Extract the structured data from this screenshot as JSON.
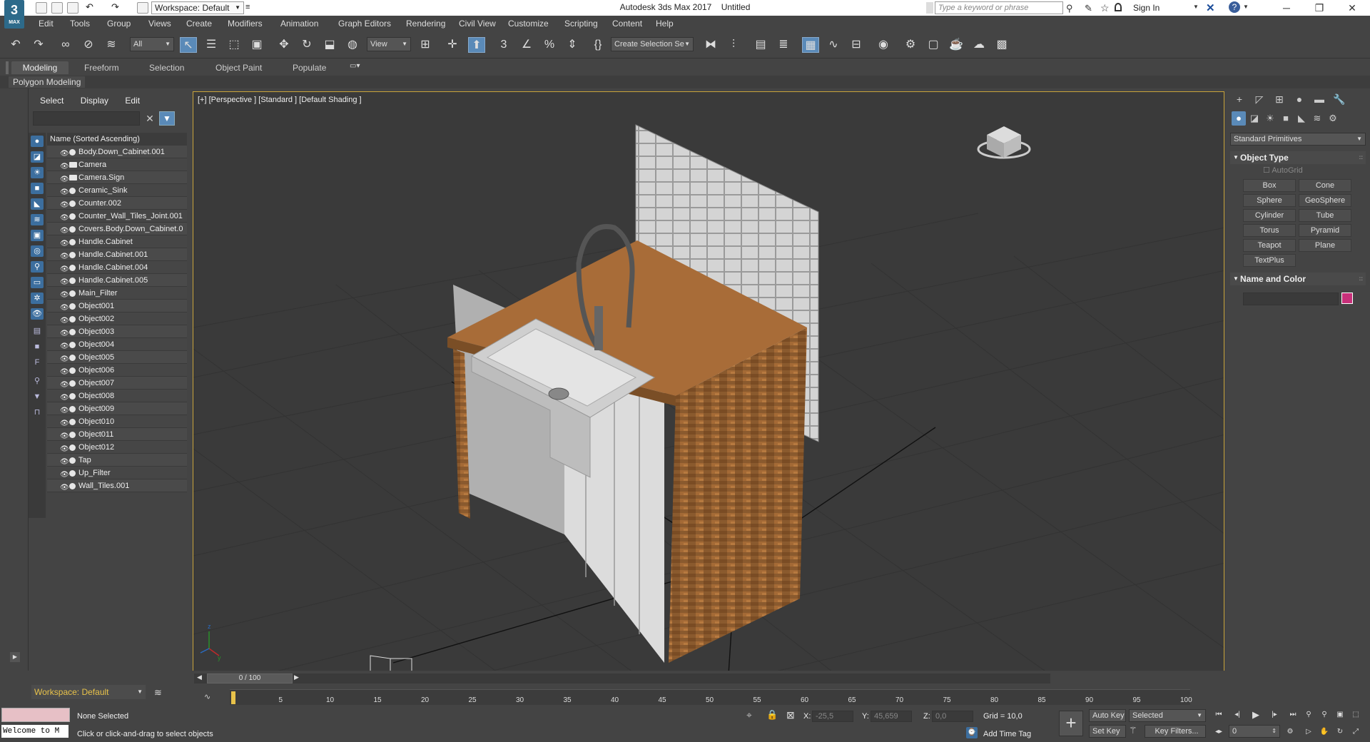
{
  "titlebar": {
    "logo": "3",
    "logo_sub": "MAX",
    "workspace": "Workspace: Default",
    "app_title": "Autodesk 3ds Max 2017",
    "doc_title": "Untitled",
    "search_placeholder": "Type a keyword or phrase",
    "sign_in": "Sign In"
  },
  "menu": [
    "Edit",
    "Tools",
    "Group",
    "Views",
    "Create",
    "Modifiers",
    "Animation",
    "Graph Editors",
    "Rendering",
    "Civil View",
    "Customize",
    "Scripting",
    "Content",
    "Help"
  ],
  "toolbar": {
    "filter_all": "All",
    "view_dd": "View",
    "selection_set": "Create Selection Se"
  },
  "ribbon": {
    "tabs": [
      "Modeling",
      "Freeform",
      "Selection",
      "Object Paint",
      "Populate"
    ],
    "sub": "Polygon Modeling"
  },
  "explorer": {
    "tabs": [
      "Select",
      "Display",
      "Edit"
    ],
    "header": "Name (Sorted Ascending)",
    "items": [
      {
        "name": "Body.Down_Cabinet.001",
        "type": "geom"
      },
      {
        "name": "Camera",
        "type": "cam"
      },
      {
        "name": "Camera.Sign",
        "type": "cam"
      },
      {
        "name": "Ceramic_Sink",
        "type": "geom"
      },
      {
        "name": "Counter.002",
        "type": "geom"
      },
      {
        "name": "Counter_Wall_Tiles_Joint.001",
        "type": "geom"
      },
      {
        "name": "Covers.Body.Down_Cabinet.0",
        "type": "geom"
      },
      {
        "name": "Handle.Cabinet",
        "type": "geom"
      },
      {
        "name": "Handle.Cabinet.001",
        "type": "geom"
      },
      {
        "name": "Handle.Cabinet.004",
        "type": "geom"
      },
      {
        "name": "Handle.Cabinet.005",
        "type": "geom"
      },
      {
        "name": "Main_Filter",
        "type": "geom"
      },
      {
        "name": "Object001",
        "type": "geom"
      },
      {
        "name": "Object002",
        "type": "geom"
      },
      {
        "name": "Object003",
        "type": "geom"
      },
      {
        "name": "Object004",
        "type": "geom"
      },
      {
        "name": "Object005",
        "type": "geom"
      },
      {
        "name": "Object006",
        "type": "geom"
      },
      {
        "name": "Object007",
        "type": "geom"
      },
      {
        "name": "Object008",
        "type": "geom"
      },
      {
        "name": "Object009",
        "type": "geom"
      },
      {
        "name": "Object010",
        "type": "geom"
      },
      {
        "name": "Object011",
        "type": "geom"
      },
      {
        "name": "Object012",
        "type": "geom"
      },
      {
        "name": "Tap",
        "type": "geom"
      },
      {
        "name": "Up_Filter",
        "type": "geom"
      },
      {
        "name": "Wall_Tiles.001",
        "type": "geom"
      }
    ]
  },
  "viewport": {
    "label": "[+] [Perspective ] [Standard ] [Default Shading ]"
  },
  "command_panel": {
    "category": "Standard Primitives",
    "object_type_title": "Object Type",
    "autogrid": "AutoGrid",
    "buttons": [
      "Box",
      "Cone",
      "Sphere",
      "GeoSphere",
      "Cylinder",
      "Tube",
      "Torus",
      "Pyramid",
      "Teapot",
      "Plane",
      "TextPlus"
    ],
    "name_color_title": "Name and Color",
    "swatch_color": "#c8307a"
  },
  "bottom": {
    "workspace": "Workspace: Default",
    "time_slider": "0 / 100",
    "ticks": [
      "5",
      "10",
      "15",
      "20",
      "25",
      "30",
      "35",
      "40",
      "45",
      "50",
      "55",
      "60",
      "65",
      "70",
      "75",
      "80",
      "85",
      "90",
      "95",
      "100"
    ],
    "welcome": "Welcome to M",
    "none_selected": "None Selected",
    "prompt": "Click or click-and-drag to select objects",
    "x_label": "X:",
    "x_val": "-25,5",
    "y_label": "Y:",
    "y_val": "45,659",
    "z_label": "Z:",
    "z_val": "0,0",
    "grid": "Grid = 10,0",
    "add_time_tag": "Add Time Tag",
    "auto_key": "Auto Key",
    "selected": "Selected",
    "set_key": "Set Key",
    "key_filters": "Key Filters...",
    "frame": "0"
  }
}
